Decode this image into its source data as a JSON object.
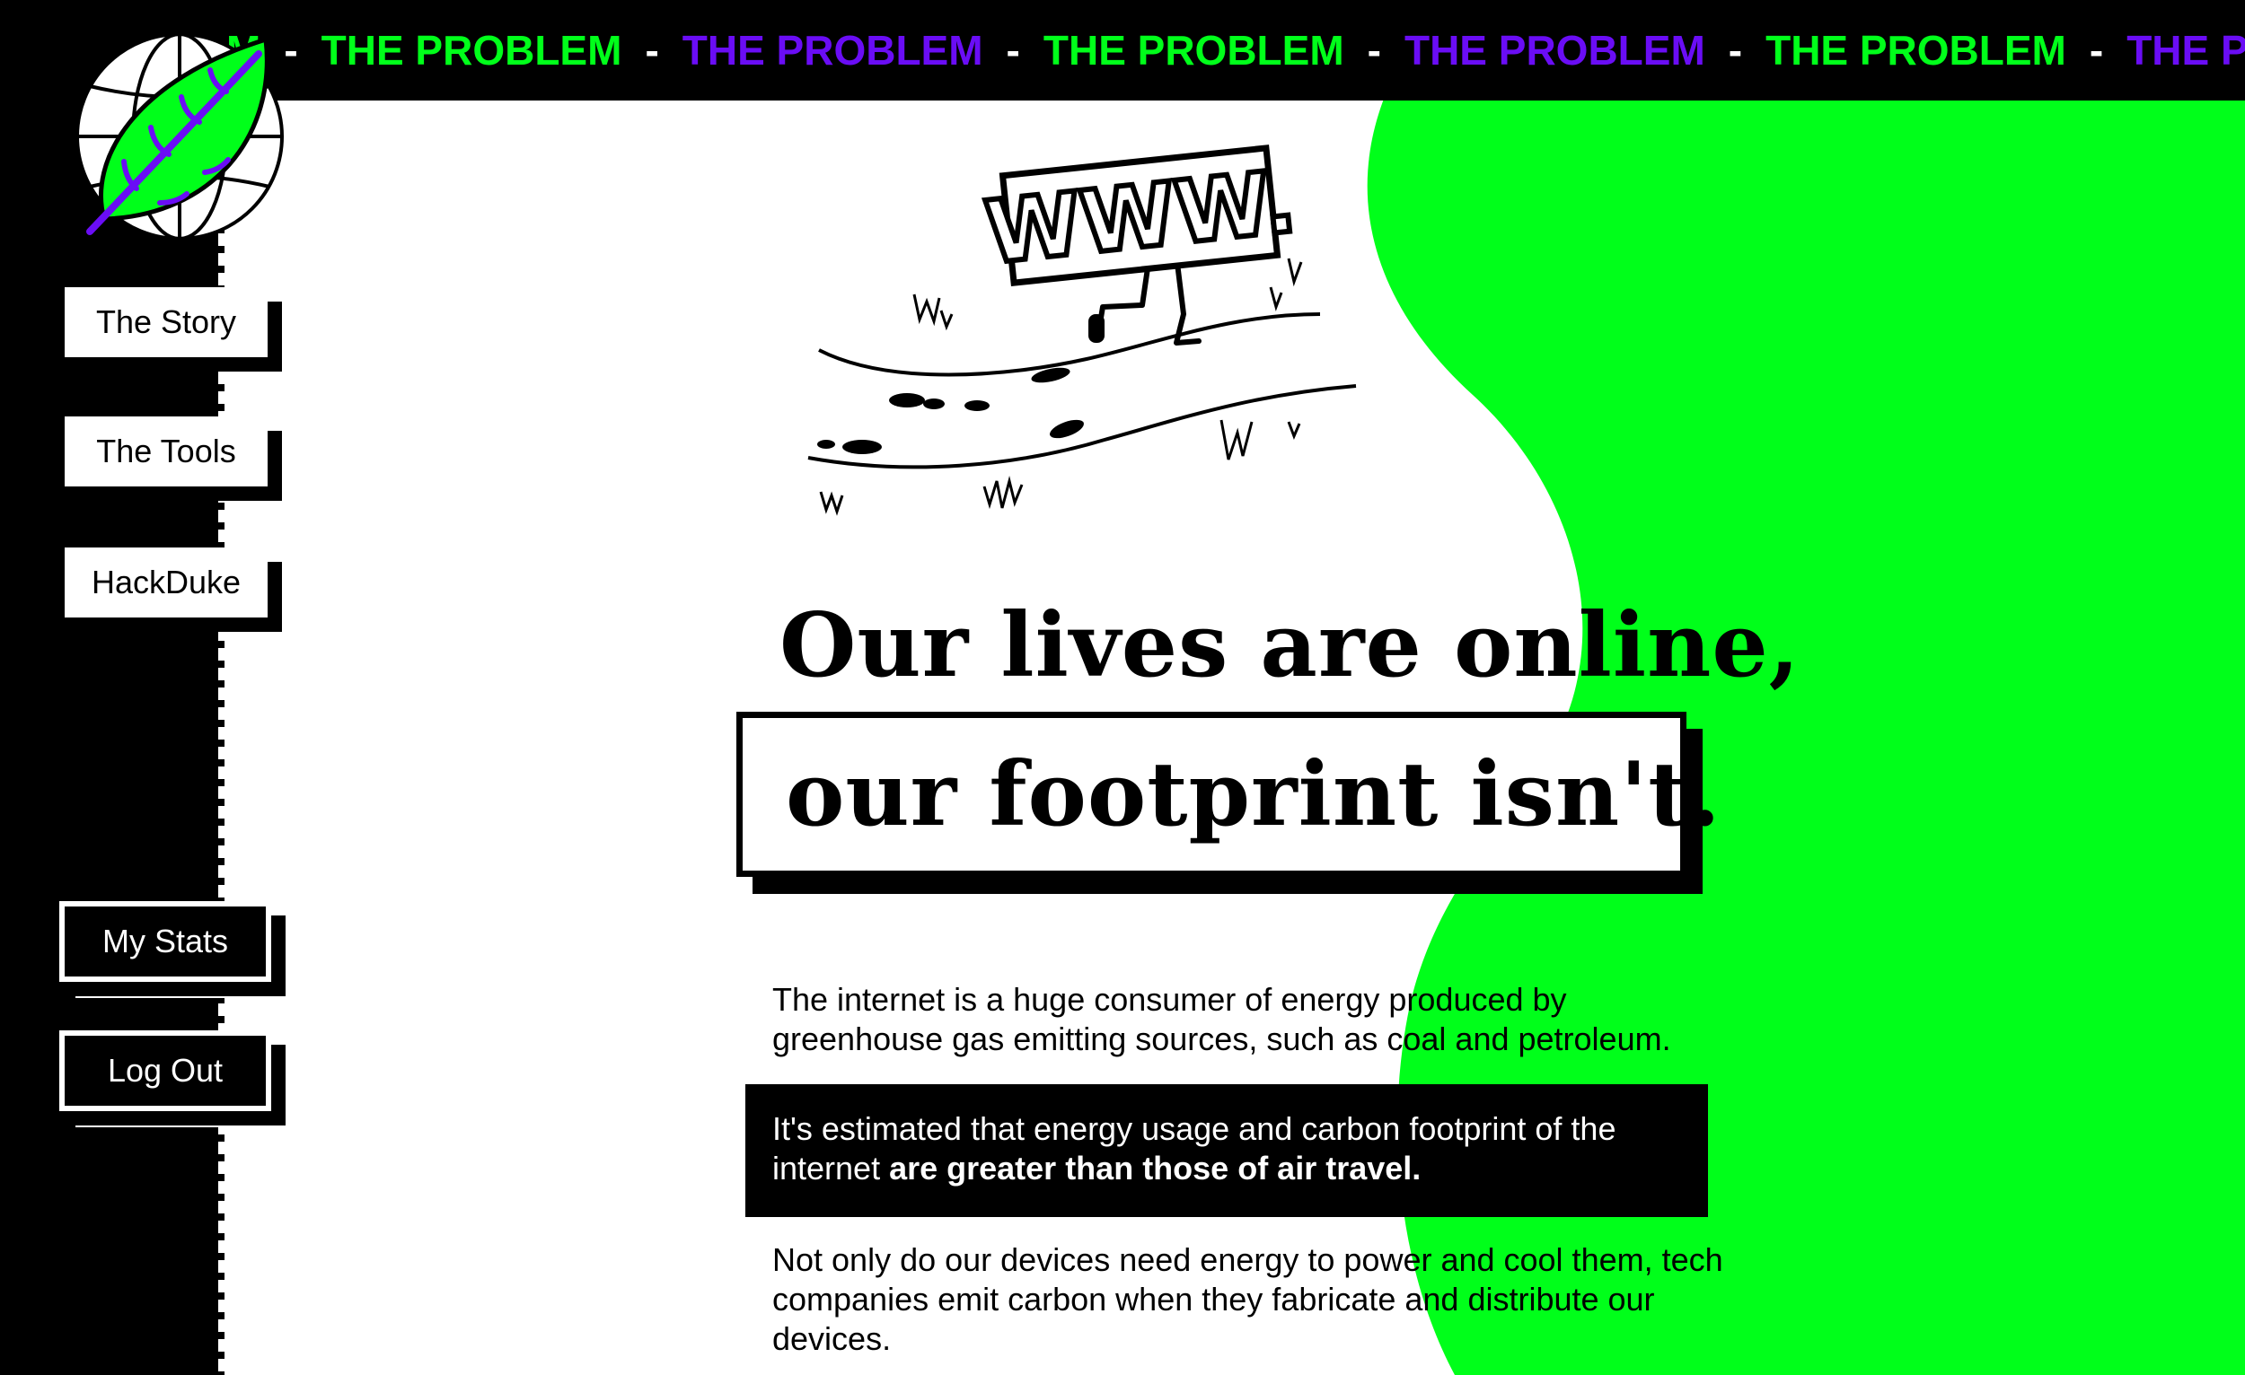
{
  "marquee": {
    "partial_start": "M",
    "items": [
      "THE PROBLEM",
      "THE PROBLEM",
      "THE PROBLEM",
      "THE PROBLEM",
      "THE PROBLEM",
      "THE PROBLE"
    ],
    "separator": "-",
    "colors": {
      "green": "#00ff1a",
      "purple": "#6a0df5"
    }
  },
  "logo": {
    "icon": "globe-leaf-icon"
  },
  "sidebar": {
    "items": [
      {
        "label": "The Story"
      },
      {
        "label": "The Tools"
      },
      {
        "label": "HackDuke"
      }
    ],
    "account": [
      {
        "label": "My Stats"
      },
      {
        "label": "Log Out"
      }
    ]
  },
  "hero": {
    "illustration": "www-running-on-road-illustration",
    "illustration_text": "WWW.",
    "headline_line1": "Our lives are online,",
    "headline_line2": "our footprint isn't."
  },
  "body": {
    "p1": "The internet is a huge consumer of energy produced by greenhouse gas emitting sources, such as coal and petroleum.",
    "p2_start": "It's estimated that energy usage and carbon footprint of the internet ",
    "p2_bold": "are greater than those of air travel.",
    "p3": "Not only do our devices need energy to power and cool them, tech companies emit carbon when they fabricate and distribute our devices."
  },
  "theme": {
    "accent_green": "#00ff1a",
    "accent_purple": "#6a0df5",
    "dark": "#000000",
    "light": "#ffffff"
  }
}
